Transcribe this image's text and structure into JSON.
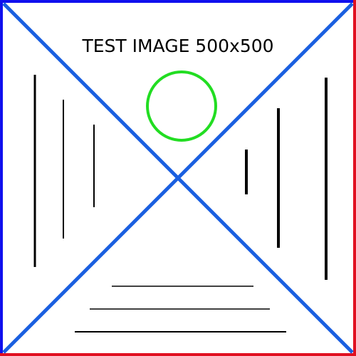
{
  "title": "TEST IMAGE 500x500",
  "colors": {
    "background": "#ffffff",
    "border_blue": "#1010ee",
    "border_red": "#e01020",
    "diagonal": "#1a5fe0",
    "circle": "#22dd22",
    "lines": "#000000"
  }
}
